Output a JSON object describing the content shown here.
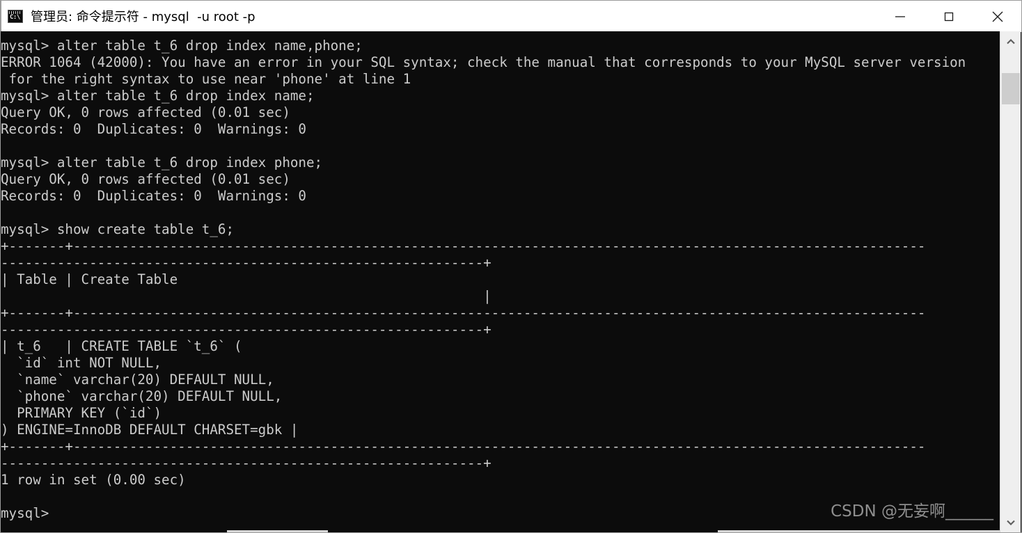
{
  "window": {
    "title": "管理员: 命令提示符 - mysql  -u root -p",
    "icon": "cmd-console-icon",
    "icon_text": "C:\\",
    "background_color": "#0c0c0c",
    "text_color": "#cccccc",
    "titlebar_color": "#ffffff"
  },
  "window_controls": {
    "minimize_label": "—",
    "maximize_label": "□",
    "close_label": "✕"
  },
  "terminal": {
    "prompt": "mysql>",
    "content": "mysql> alter table t_6 drop index name,phone;\nERROR 1064 (42000): You have an error in your SQL syntax; check the manual that corresponds to your MySQL server version\n for the right syntax to use near 'phone' at line 1\nmysql> alter table t_6 drop index name;\nQuery OK, 0 rows affected (0.01 sec)\nRecords: 0  Duplicates: 0  Warnings: 0\n\nmysql> alter table t_6 drop index phone;\nQuery OK, 0 rows affected (0.01 sec)\nRecords: 0  Duplicates: 0  Warnings: 0\n\nmysql> show create table t_6;\n+-------+----------------------------------------------------------------------------------------------------------\n------------------------------------------------------------+\n| Table | Create Table\n                                                            |\n+-------+----------------------------------------------------------------------------------------------------------\n------------------------------------------------------------+\n| t_6   | CREATE TABLE `t_6` (\n  `id` int NOT NULL,\n  `name` varchar(20) DEFAULT NULL,\n  `phone` varchar(20) DEFAULT NULL,\n  PRIMARY KEY (`id`)\n) ENGINE=InnoDB DEFAULT CHARSET=gbk |\n+-------+----------------------------------------------------------------------------------------------------------\n------------------------------------------------------------+\n1 row in set (0.00 sec)\n\nmysql>",
    "lines": [
      "mysql> alter table t_6 drop index name,phone;",
      "ERROR 1064 (42000): You have an error in your SQL syntax; check the manual that corresponds to your MySQL server version",
      " for the right syntax to use near 'phone' at line 1",
      "mysql> alter table t_6 drop index name;",
      "Query OK, 0 rows affected (0.01 sec)",
      "Records: 0  Duplicates: 0  Warnings: 0",
      "",
      "mysql> alter table t_6 drop index phone;",
      "Query OK, 0 rows affected (0.01 sec)",
      "Records: 0  Duplicates: 0  Warnings: 0",
      "",
      "mysql> show create table t_6;",
      "+-------+----------------------------------------------------------------------------------------------------------",
      "------------------------------------------------------------+",
      "| Table | Create Table",
      "                                                            |",
      "+-------+----------------------------------------------------------------------------------------------------------",
      "------------------------------------------------------------+",
      "| t_6   | CREATE TABLE `t_6` (",
      "  `id` int NOT NULL,",
      "  `name` varchar(20) DEFAULT NULL,",
      "  `phone` varchar(20) DEFAULT NULL,",
      "  PRIMARY KEY (`id`)",
      ") ENGINE=InnoDB DEFAULT CHARSET=gbk |",
      "+-------+----------------------------------------------------------------------------------------------------------",
      "------------------------------------------------------------+",
      "1 row in set (0.00 sec)",
      "",
      "mysql>"
    ],
    "commands": [
      "alter table t_6 drop index name,phone;",
      "alter table t_6 drop index name;",
      "alter table t_6 drop index phone;",
      "show create table t_6;"
    ],
    "results": {
      "error_code": "ERROR 1064 (42000)",
      "query_ok": "Query OK, 0 rows affected (0.01 sec)",
      "records": "Records: 0  Duplicates: 0  Warnings: 0",
      "row_count": "1 row in set (0.00 sec)"
    },
    "table_result": {
      "headers": [
        "Table",
        "Create Table"
      ],
      "row": {
        "table": "t_6",
        "create_table": ") ENGINE=InnoDB DEFAULT CHARSET=gbk"
      }
    }
  },
  "watermark": {
    "text": "CSDN @无妄啊______"
  },
  "scrollbar": {
    "up_arrow": "▲",
    "down_arrow": "▼"
  }
}
